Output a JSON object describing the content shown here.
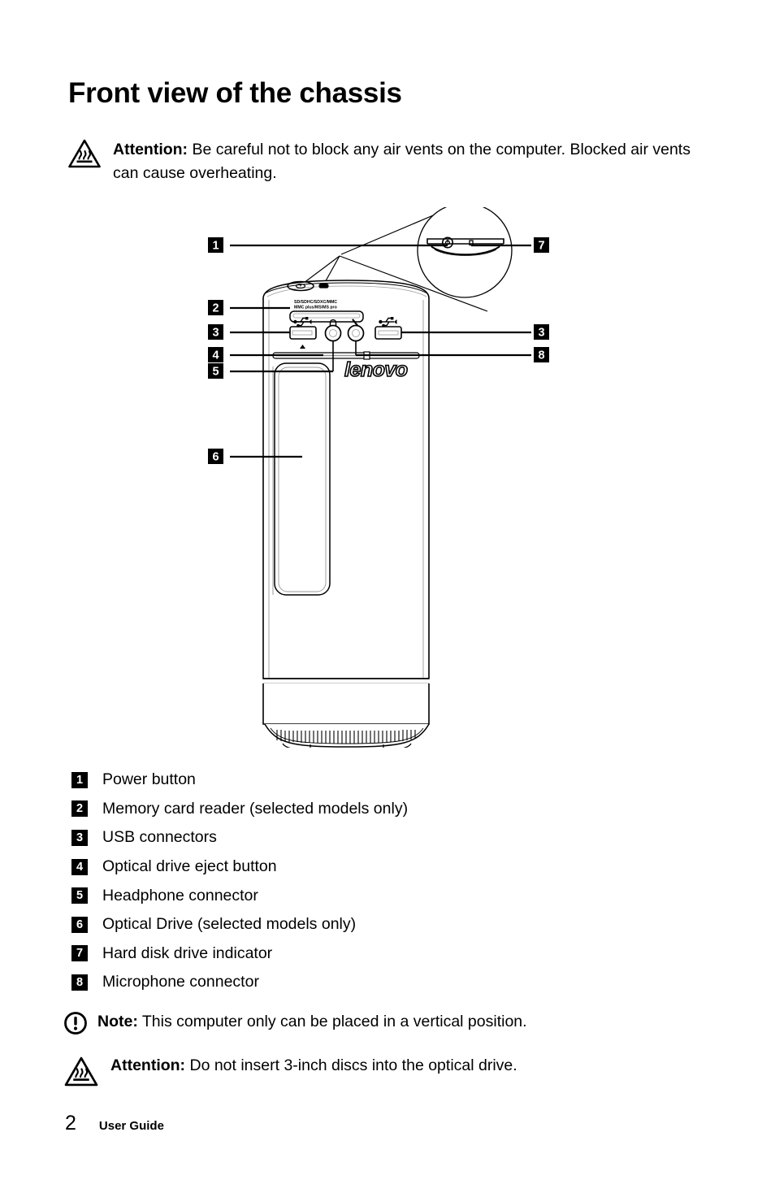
{
  "page": {
    "title": "Front view of the chassis",
    "footer": {
      "page_number": "2",
      "document_name": "User Guide"
    }
  },
  "notices": {
    "attention_top": {
      "icon": "hot-surface-warning-icon",
      "label": "Attention:",
      "text": " Be careful not to block any air vents on the computer. Blocked air vents can cause overheating."
    },
    "note_bottom": {
      "icon": "exclamation-circle-icon",
      "label": "Note:",
      "text": " This computer only can be placed in a vertical position."
    },
    "attention_bottom": {
      "icon": "hot-surface-warning-icon",
      "label": "Attention:",
      "text": " Do not insert 3-inch discs into the optical drive."
    }
  },
  "legend": {
    "items": [
      {
        "number": "1",
        "label": "Power button"
      },
      {
        "number": "2",
        "label": "Memory card reader (selected models only)"
      },
      {
        "number": "3",
        "label": "USB connectors"
      },
      {
        "number": "4",
        "label": "Optical drive eject button"
      },
      {
        "number": "5",
        "label": "Headphone connector"
      },
      {
        "number": "6",
        "label": "Optical Drive (selected models only)"
      },
      {
        "number": "7",
        "label": "Hard disk drive indicator"
      },
      {
        "number": "8",
        "label": "Microphone connector"
      }
    ]
  },
  "diagram": {
    "description": "Front view line drawing of a Lenovo desktop tower chassis with numbered callouts and a magnified detail circle of the top cap",
    "brand_logo": "lenovo",
    "card_reader_label_line1": "SD/SDHC/SDXC/MMC",
    "card_reader_label_line2": "MMC plus/MS/MS pro",
    "callouts_left": [
      {
        "number": "1",
        "target": "power-button"
      },
      {
        "number": "2",
        "target": "memory-card-reader"
      },
      {
        "number": "3",
        "target": "usb-connector-left"
      },
      {
        "number": "4",
        "target": "optical-drive-eject-button"
      },
      {
        "number": "5",
        "target": "headphone-connector"
      },
      {
        "number": "6",
        "target": "optical-drive-bay"
      }
    ],
    "callouts_right": [
      {
        "number": "7",
        "target": "hard-disk-drive-indicator"
      },
      {
        "number": "3",
        "target": "usb-connector-right"
      },
      {
        "number": "8",
        "target": "microphone-connector"
      }
    ],
    "port_icons": {
      "usb_left": "usb-icon",
      "headphone": "headphone-icon",
      "microphone": "microphone-icon",
      "usb_right": "usb-icon",
      "eject": "eject-triangle-icon"
    }
  }
}
